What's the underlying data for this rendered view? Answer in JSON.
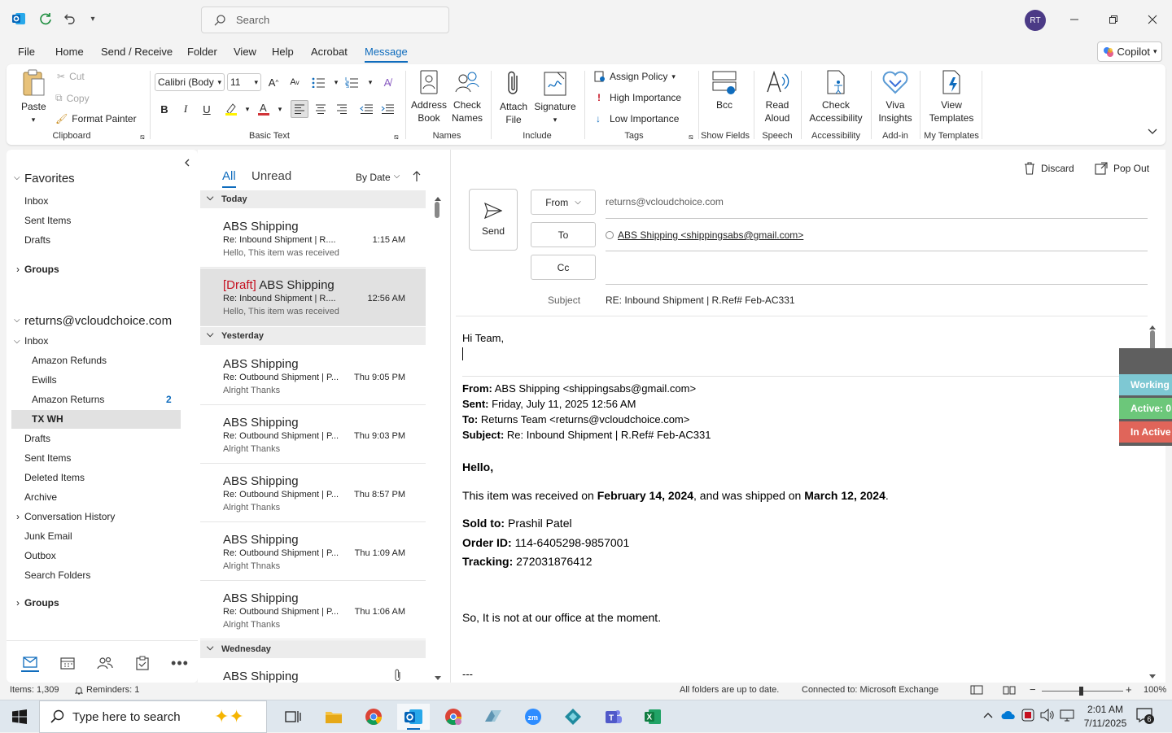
{
  "titlebar": {
    "search_placeholder": "Search",
    "avatar_initials": "RT"
  },
  "menu": {
    "items": [
      "File",
      "Home",
      "Send / Receive",
      "Folder",
      "View",
      "Help",
      "Acrobat",
      "Message"
    ],
    "active": "Message",
    "copilot": "Copilot"
  },
  "ribbon": {
    "clipboard": {
      "label": "Clipboard",
      "paste": "Paste",
      "cut": "Cut",
      "copy": "Copy",
      "format_painter": "Format Painter"
    },
    "basic_text": {
      "label": "Basic Text",
      "font": "Calibri (Body",
      "size": "11"
    },
    "names": {
      "label": "Names",
      "address_book_1": "Address",
      "address_book_2": "Book",
      "check_names_1": "Check",
      "check_names_2": "Names"
    },
    "include": {
      "label": "Include",
      "attach_1": "Attach",
      "attach_2": "File",
      "signature": "Signature"
    },
    "tags": {
      "label": "Tags",
      "assign_policy": "Assign Policy",
      "high": "High Importance",
      "low": "Low Importance"
    },
    "show_fields": {
      "label": "Show Fields",
      "bcc": "Bcc"
    },
    "speech": {
      "label": "Speech",
      "read_1": "Read",
      "read_2": "Aloud"
    },
    "accessibility": {
      "label": "Accessibility",
      "check_1": "Check",
      "check_2": "Accessibility"
    },
    "addin": {
      "label": "Add-in",
      "viva_1": "Viva",
      "viva_2": "Insights"
    },
    "templates": {
      "label": "My Templates",
      "view_1": "View",
      "view_2": "Templates"
    }
  },
  "folders": {
    "favorites": "Favorites",
    "fav_items": [
      "Inbox",
      "Sent Items",
      "Drafts"
    ],
    "groups1": "Groups",
    "account": "returns@vcloudchoice.com",
    "inbox": "Inbox",
    "sub": [
      "Amazon Refunds",
      "Ewills",
      "Amazon Returns",
      "TX WH"
    ],
    "amazon_returns_count": "2",
    "rest": [
      "Drafts",
      "Sent Items",
      "Deleted Items",
      "Archive",
      "Conversation History",
      "Junk Email",
      "Outbox",
      "Search Folders"
    ],
    "groups2": "Groups"
  },
  "list": {
    "tab_all": "All",
    "tab_unread": "Unread",
    "sort": "By Date",
    "today": "Today",
    "yesterday": "Yesterday",
    "wednesday": "Wednesday",
    "messages": [
      {
        "sender": "ABS Shipping",
        "subject": "Re: Inbound Shipment | R....",
        "time": "1:15 AM",
        "preview": "Hello,  This item was received"
      },
      {
        "draft": "[Draft]",
        "sender": "ABS Shipping",
        "subject": "Re: Inbound Shipment | R....",
        "time": "12:56 AM",
        "preview": "Hello,  This item was received"
      },
      {
        "sender": "ABS Shipping",
        "subject": "Re: Outbound Shipment | P...",
        "time": "Thu 9:05 PM",
        "preview": "Alright  Thanks"
      },
      {
        "sender": "ABS Shipping",
        "subject": "Re: Outbound Shipment | P...",
        "time": "Thu 9:03 PM",
        "preview": "Alright  Thanks"
      },
      {
        "sender": "ABS Shipping",
        "subject": "Re: Outbound Shipment | P...",
        "time": "Thu 8:57 PM",
        "preview": "Alright  Thanks"
      },
      {
        "sender": "ABS Shipping",
        "subject": "Re: Outbound Shipment | P...",
        "time": "Thu 1:09 AM",
        "preview": "Alright  Thnaks"
      },
      {
        "sender": "ABS Shipping",
        "subject": "Re: Outbound Shipment | P...",
        "time": "Thu 1:06 AM",
        "preview": "Alright  Thanks"
      },
      {
        "sender": "ABS Shipping"
      }
    ]
  },
  "compose": {
    "discard": "Discard",
    "pop_out": "Pop Out",
    "send": "Send",
    "from_label": "From",
    "from_value": "returns@vcloudchoice.com",
    "to_label": "To",
    "to_value": "ABS Shipping <shippingsabs@gmail.com>",
    "cc_label": "Cc",
    "subject_label": "Subject",
    "subject_value": "RE: Inbound Shipment | R.Ref# Feb-AC331",
    "greeting": "Hi Team,",
    "q_from_l": "From:",
    "q_from": "ABS Shipping <shippingsabs@gmail.com>",
    "q_sent_l": "Sent:",
    "q_sent": "Friday, July 11, 2025 12:56 AM",
    "q_to_l": "To:",
    "q_to": "Returns Team <returns@vcloudchoice.com>",
    "q_subj_l": "Subject:",
    "q_subj": "Re: Inbound Shipment | R.Ref# Feb-AC331",
    "hello": "Hello,",
    "line1_a": "This item was received on ",
    "line1_b": "February 14, 2024",
    "line1_c": ", and was shipped on ",
    "line1_d": "March 12, 2024",
    "line1_e": ".",
    "sold_l": "Sold to:",
    "sold": "Prashil Patel",
    "order_l": "Order ID:",
    "order": "114-6405298-9857001",
    "track_l": "Tracking:",
    "track": "272031876412",
    "note": "So, It is not at our office at the moment.",
    "sig": "---"
  },
  "widget": {
    "working": "Working",
    "active": "Active: 0",
    "inactive": "In Active"
  },
  "status": {
    "items": "Items: 1,309",
    "reminders": "Reminders: 1",
    "uptodate": "All folders are up to date.",
    "connected": "Connected to: Microsoft Exchange",
    "zoom": "100%"
  },
  "taskbar": {
    "search": "Type here to search",
    "time": "2:01 AM",
    "date": "7/11/2025",
    "notifications": "6"
  },
  "colors": {
    "accent": "#0f6cbd",
    "draft_red": "#c50f1f",
    "working": "#7ec8d3",
    "active": "#6cc77a",
    "inactive": "#e0655a"
  }
}
